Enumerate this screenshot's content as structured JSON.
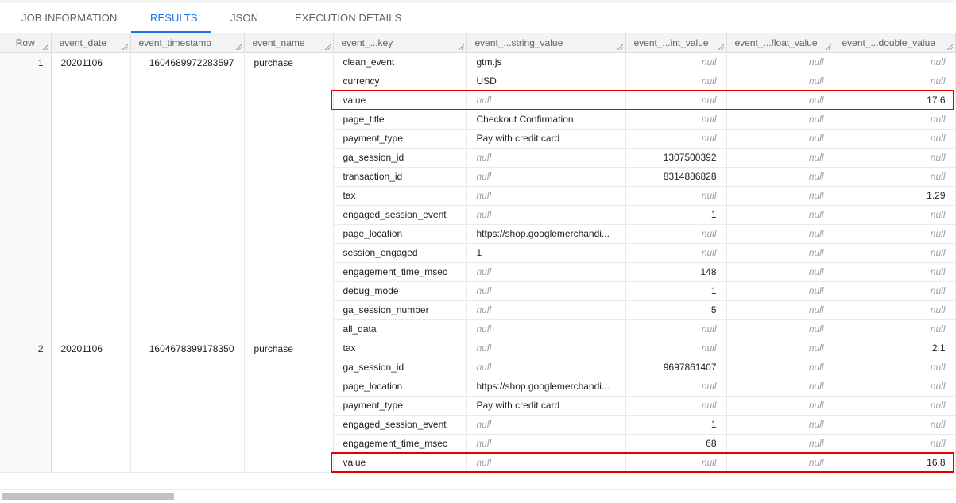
{
  "tabs": [
    {
      "label": "JOB INFORMATION",
      "active": false
    },
    {
      "label": "RESULTS",
      "active": true
    },
    {
      "label": "JSON",
      "active": false
    },
    {
      "label": "EXECUTION DETAILS",
      "active": false
    }
  ],
  "columns": [
    "Row",
    "event_date",
    "event_timestamp",
    "event_name",
    "event_...key",
    "event_...string_value",
    "event_...int_value",
    "event_...float_value",
    "event_...double_value"
  ],
  "null_label": "null",
  "records": [
    {
      "row": "1",
      "event_date": "20201106",
      "event_timestamp": "1604689972283597",
      "event_name": "purchase",
      "params": [
        {
          "key": "clean_event",
          "string": "gtm.js",
          "int": "null",
          "float": "null",
          "double": "null"
        },
        {
          "key": "currency",
          "string": "USD",
          "int": "null",
          "float": "null",
          "double": "null"
        },
        {
          "key": "value",
          "string": "null",
          "int": "null",
          "float": "null",
          "double": "17.6",
          "highlight": true
        },
        {
          "key": "page_title",
          "string": "Checkout Confirmation",
          "int": "null",
          "float": "null",
          "double": "null"
        },
        {
          "key": "payment_type",
          "string": "Pay with credit card",
          "int": "null",
          "float": "null",
          "double": "null"
        },
        {
          "key": "ga_session_id",
          "string": "null",
          "int": "1307500392",
          "float": "null",
          "double": "null"
        },
        {
          "key": "transaction_id",
          "string": "null",
          "int": "8314886828",
          "float": "null",
          "double": "null"
        },
        {
          "key": "tax",
          "string": "null",
          "int": "null",
          "float": "null",
          "double": "1.29"
        },
        {
          "key": "engaged_session_event",
          "string": "null",
          "int": "1",
          "float": "null",
          "double": "null"
        },
        {
          "key": "page_location",
          "string": "https://shop.googlemerchandi...",
          "int": "null",
          "float": "null",
          "double": "null"
        },
        {
          "key": "session_engaged",
          "string": "1",
          "int": "null",
          "float": "null",
          "double": "null"
        },
        {
          "key": "engagement_time_msec",
          "string": "null",
          "int": "148",
          "float": "null",
          "double": "null"
        },
        {
          "key": "debug_mode",
          "string": "null",
          "int": "1",
          "float": "null",
          "double": "null"
        },
        {
          "key": "ga_session_number",
          "string": "null",
          "int": "5",
          "float": "null",
          "double": "null"
        },
        {
          "key": "all_data",
          "string": "null",
          "int": "null",
          "float": "null",
          "double": "null"
        }
      ]
    },
    {
      "row": "2",
      "event_date": "20201106",
      "event_timestamp": "1604678399178350",
      "event_name": "purchase",
      "params": [
        {
          "key": "tax",
          "string": "null",
          "int": "null",
          "float": "null",
          "double": "2.1"
        },
        {
          "key": "ga_session_id",
          "string": "null",
          "int": "9697861407",
          "float": "null",
          "double": "null"
        },
        {
          "key": "page_location",
          "string": "https://shop.googlemerchandi...",
          "int": "null",
          "float": "null",
          "double": "null"
        },
        {
          "key": "payment_type",
          "string": "Pay with credit card",
          "int": "null",
          "float": "null",
          "double": "null"
        },
        {
          "key": "engaged_session_event",
          "string": "null",
          "int": "1",
          "float": "null",
          "double": "null"
        },
        {
          "key": "engagement_time_msec",
          "string": "null",
          "int": "68",
          "float": "null",
          "double": "null"
        },
        {
          "key": "value",
          "string": "null",
          "int": "null",
          "float": "null",
          "double": "16.8",
          "highlight": true
        }
      ]
    }
  ],
  "colors": {
    "accent": "#1a73e8",
    "highlight": "#e00000",
    "null_text": "#9aa0a6"
  }
}
